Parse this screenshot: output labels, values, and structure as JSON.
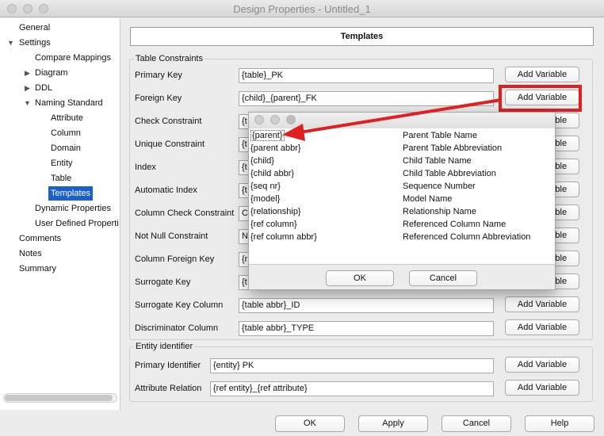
{
  "window": {
    "title": "Design Properties - Untitled_1"
  },
  "tree": {
    "items": [
      {
        "label": "General",
        "expander": ""
      },
      {
        "label": "Settings",
        "expander": "▼"
      },
      {
        "label": "Compare Mappings",
        "expander": ""
      },
      {
        "label": "Diagram",
        "expander": "▶"
      },
      {
        "label": "DDL",
        "expander": "▶"
      },
      {
        "label": "Naming Standard",
        "expander": "▼"
      },
      {
        "label": "Attribute",
        "expander": ""
      },
      {
        "label": "Column",
        "expander": ""
      },
      {
        "label": "Domain",
        "expander": ""
      },
      {
        "label": "Entity",
        "expander": ""
      },
      {
        "label": "Table",
        "expander": ""
      },
      {
        "label": "Templates",
        "expander": "",
        "selected": true
      },
      {
        "label": "Dynamic Properties",
        "expander": ""
      },
      {
        "label": "User Defined Properti",
        "expander": ""
      },
      {
        "label": "Comments",
        "expander": ""
      },
      {
        "label": "Notes",
        "expander": ""
      },
      {
        "label": "Summary",
        "expander": ""
      }
    ]
  },
  "main": {
    "header": "Templates",
    "add_variable_label": "Add Variable",
    "table_constraints": {
      "legend": "Table Constraints",
      "rows": [
        {
          "label": "Primary Key",
          "value": "{table}_PK"
        },
        {
          "label": "Foreign Key",
          "value": "{child}_{parent}_FK"
        },
        {
          "label": "Check Constraint",
          "value": "{t"
        },
        {
          "label": "Unique Constraint",
          "value": "{t"
        },
        {
          "label": "Index",
          "value": "{t"
        },
        {
          "label": "Automatic Index",
          "value": "{t"
        },
        {
          "label": "Column Check Constraint",
          "value": "C"
        },
        {
          "label": "Not Null Constraint",
          "value": "N"
        },
        {
          "label": "Column Foreign Key",
          "value": "{r"
        },
        {
          "label": "Surrogate Key",
          "value": "{t"
        },
        {
          "label": "Surrogate Key Column",
          "value": "{table abbr}_ID"
        },
        {
          "label": "Discriminator Column",
          "value": "{table abbr}_TYPE"
        }
      ]
    },
    "entity_identifier": {
      "legend": "Entity identifier",
      "rows": [
        {
          "label": "Primary Identifier",
          "value": "{entity} PK"
        },
        {
          "label": "Attribute Relation",
          "value": "{ref entity}_{ref attribute}"
        }
      ]
    }
  },
  "popup": {
    "variables": [
      {
        "var": "{parent}",
        "desc": "Parent Table Name"
      },
      {
        "var": "{parent abbr}",
        "desc": "Parent Table Abbreviation"
      },
      {
        "var": "{child}",
        "desc": "Child Table Name"
      },
      {
        "var": "{child abbr}",
        "desc": "Child Table Abbreviation"
      },
      {
        "var": "{seq nr}",
        "desc": "Sequence Number"
      },
      {
        "var": "{model}",
        "desc": "Model Name"
      },
      {
        "var": "{relationship}",
        "desc": "Relationship Name"
      },
      {
        "var": "{ref column}",
        "desc": "Referenced Column Name"
      },
      {
        "var": "{ref column abbr}",
        "desc": "Referenced Column Abbreviation"
      }
    ],
    "ok_label": "OK",
    "cancel_label": "Cancel"
  },
  "bottom": {
    "ok_label": "OK",
    "apply_label": "Apply",
    "cancel_label": "Cancel",
    "help_label": "Help"
  },
  "colors": {
    "highlight": "#e02020",
    "selection": "#1b5fcf"
  },
  "icons": {
    "expanded": "triangle-down-icon",
    "collapsed": "triangle-right-icon"
  }
}
